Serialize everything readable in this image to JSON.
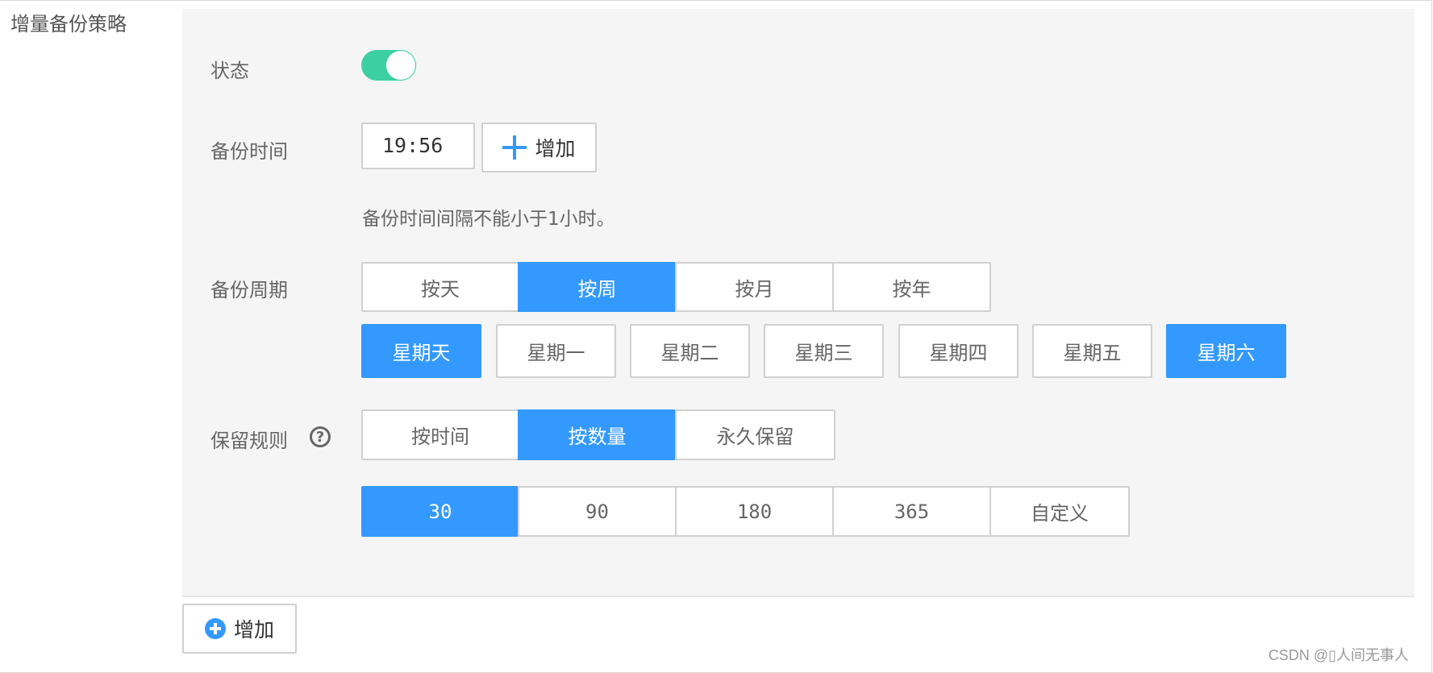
{
  "section_title": "增量备份策略",
  "status": {
    "label": "状态",
    "enabled": true
  },
  "backup_time": {
    "label": "备份时间",
    "value": "19:56",
    "add_label": "增加",
    "hint": "备份时间间隔不能小于1小时。"
  },
  "backup_cycle": {
    "label": "备份周期",
    "options": [
      {
        "label": "按天",
        "active": false
      },
      {
        "label": "按周",
        "active": true
      },
      {
        "label": "按月",
        "active": false
      },
      {
        "label": "按年",
        "active": false
      }
    ],
    "weekdays": [
      {
        "label": "星期天",
        "active": true
      },
      {
        "label": "星期一",
        "active": false
      },
      {
        "label": "星期二",
        "active": false
      },
      {
        "label": "星期三",
        "active": false
      },
      {
        "label": "星期四",
        "active": false
      },
      {
        "label": "星期五",
        "active": false
      },
      {
        "label": "星期六",
        "active": true
      }
    ]
  },
  "retention": {
    "label": "保留规则",
    "help_icon": "?",
    "options": [
      {
        "label": "按时间",
        "active": false
      },
      {
        "label": "按数量",
        "active": true
      },
      {
        "label": "永久保留",
        "active": false
      }
    ],
    "counts": [
      {
        "label": "30",
        "active": true
      },
      {
        "label": "90",
        "active": false
      },
      {
        "label": "180",
        "active": false
      },
      {
        "label": "365",
        "active": false
      },
      {
        "label": "自定义",
        "active": false
      }
    ]
  },
  "footer": {
    "add_label": "增加"
  },
  "watermark": "CSDN @\u0000人间无事人",
  "colors": {
    "accent": "#3399ff",
    "toggle_on": "#3ccfa1",
    "panel_bg": "#f5f5f5"
  }
}
